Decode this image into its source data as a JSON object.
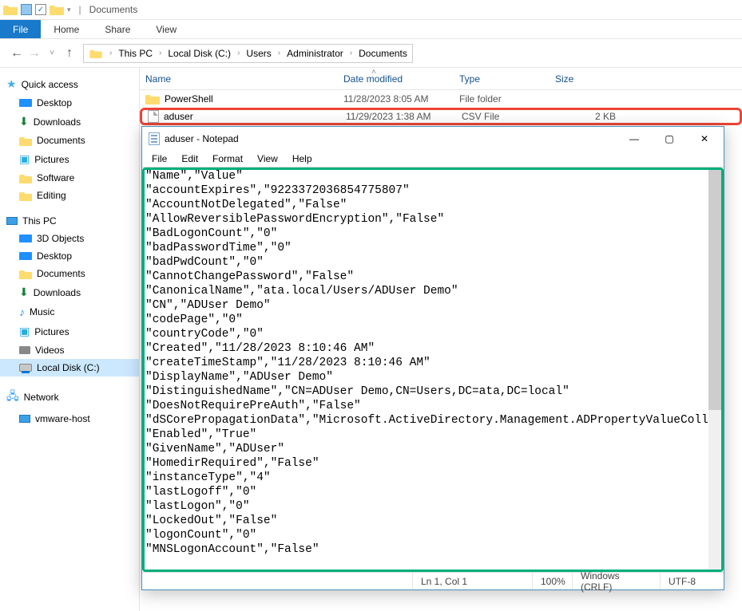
{
  "explorer": {
    "title": "Documents",
    "tabs": {
      "file": "File",
      "home": "Home",
      "share": "Share",
      "view": "View"
    },
    "breadcrumb": [
      "This PC",
      "Local Disk (C:)",
      "Users",
      "Administrator",
      "Documents"
    ],
    "columns": {
      "name": "Name",
      "date": "Date modified",
      "type": "Type",
      "size": "Size"
    },
    "nav": {
      "quick": "Quick access",
      "quick_items": [
        "Desktop",
        "Downloads",
        "Documents",
        "Pictures",
        "Software",
        "Editing"
      ],
      "thispc": "This PC",
      "pc_items": [
        "3D Objects",
        "Desktop",
        "Documents",
        "Downloads",
        "Music",
        "Pictures",
        "Videos",
        "Local Disk (C:)"
      ],
      "network": "Network",
      "net_items": [
        "vmware-host"
      ]
    },
    "files": [
      {
        "name": "PowerShell",
        "date": "11/28/2023 8:05 AM",
        "type": "File folder",
        "size": ""
      },
      {
        "name": "aduser",
        "date": "11/29/2023 1:38 AM",
        "type": "CSV File",
        "size": "2 KB"
      }
    ]
  },
  "notepad": {
    "title": "aduser - Notepad",
    "menu": [
      "File",
      "Edit",
      "Format",
      "View",
      "Help"
    ],
    "lines": [
      "\"Name\",\"Value\"",
      "\"accountExpires\",\"9223372036854775807\"",
      "\"AccountNotDelegated\",\"False\"",
      "\"AllowReversiblePasswordEncryption\",\"False\"",
      "\"BadLogonCount\",\"0\"",
      "\"badPasswordTime\",\"0\"",
      "\"badPwdCount\",\"0\"",
      "\"CannotChangePassword\",\"False\"",
      "\"CanonicalName\",\"ata.local/Users/ADUser Demo\"",
      "\"CN\",\"ADUser Demo\"",
      "\"codePage\",\"0\"",
      "\"countryCode\",\"0\"",
      "\"Created\",\"11/28/2023 8:10:46 AM\"",
      "\"createTimeStamp\",\"11/28/2023 8:10:46 AM\"",
      "\"DisplayName\",\"ADUser Demo\"",
      "\"DistinguishedName\",\"CN=ADUser Demo,CN=Users,DC=ata,DC=local\"",
      "\"DoesNotRequirePreAuth\",\"False\"",
      "\"dSCorePropagationData\",\"Microsoft.ActiveDirectory.Management.ADPropertyValueCollection\"",
      "\"Enabled\",\"True\"",
      "\"GivenName\",\"ADUser\"",
      "\"HomedirRequired\",\"False\"",
      "\"instanceType\",\"4\"",
      "\"lastLogoff\",\"0\"",
      "\"lastLogon\",\"0\"",
      "\"LockedOut\",\"False\"",
      "\"logonCount\",\"0\"",
      "\"MNSLogonAccount\",\"False\""
    ],
    "status": {
      "pos": "Ln 1, Col 1",
      "zoom": "100%",
      "eol": "Windows (CRLF)",
      "enc": "UTF-8"
    }
  }
}
